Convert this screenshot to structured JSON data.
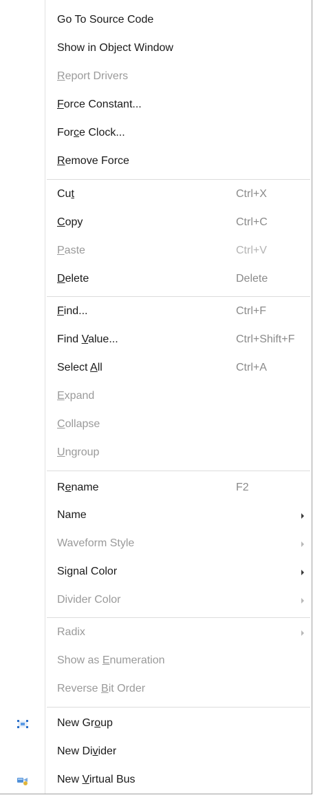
{
  "menu": {
    "items": [
      {
        "pre": "Go To Source Code",
        "mn": "",
        "post": "",
        "shortcut": "",
        "enabled": true,
        "submenu": false
      },
      {
        "pre": "Show in Object Window",
        "mn": "",
        "post": "",
        "shortcut": "",
        "enabled": true,
        "submenu": false
      },
      {
        "pre": "",
        "mn": "R",
        "post": "eport Drivers",
        "shortcut": "",
        "enabled": false,
        "submenu": false
      },
      {
        "pre": "",
        "mn": "F",
        "post": "orce Constant...",
        "shortcut": "",
        "enabled": true,
        "submenu": false
      },
      {
        "pre": "For",
        "mn": "c",
        "post": "e Clock...",
        "shortcut": "",
        "enabled": true,
        "submenu": false
      },
      {
        "pre": "",
        "mn": "R",
        "post": "emove Force",
        "shortcut": "",
        "enabled": true,
        "submenu": false
      },
      {
        "pre": "Cu",
        "mn": "t",
        "post": "",
        "shortcut": "Ctrl+X",
        "enabled": true,
        "submenu": false
      },
      {
        "pre": "",
        "mn": "C",
        "post": "opy",
        "shortcut": "Ctrl+C",
        "enabled": true,
        "submenu": false
      },
      {
        "pre": "",
        "mn": "P",
        "post": "aste",
        "shortcut": "Ctrl+V",
        "enabled": false,
        "submenu": false
      },
      {
        "pre": "",
        "mn": "D",
        "post": "elete",
        "shortcut": "Delete",
        "enabled": true,
        "submenu": false
      },
      {
        "pre": "",
        "mn": "F",
        "post": "ind...",
        "shortcut": "Ctrl+F",
        "enabled": true,
        "submenu": false
      },
      {
        "pre": "Find ",
        "mn": "V",
        "post": "alue...",
        "shortcut": "Ctrl+Shift+F",
        "enabled": true,
        "submenu": false
      },
      {
        "pre": "Select ",
        "mn": "A",
        "post": "ll",
        "shortcut": "Ctrl+A",
        "enabled": true,
        "submenu": false
      },
      {
        "pre": "",
        "mn": "E",
        "post": "xpand",
        "shortcut": "",
        "enabled": false,
        "submenu": false
      },
      {
        "pre": "",
        "mn": "C",
        "post": "ollapse",
        "shortcut": "",
        "enabled": false,
        "submenu": false
      },
      {
        "pre": "",
        "mn": "U",
        "post": "ngroup",
        "shortcut": "",
        "enabled": false,
        "submenu": false
      },
      {
        "pre": "R",
        "mn": "e",
        "post": "name",
        "shortcut": "F2",
        "enabled": true,
        "submenu": false
      },
      {
        "pre": "Name",
        "mn": "",
        "post": "",
        "shortcut": "",
        "enabled": true,
        "submenu": true
      },
      {
        "pre": "Waveform Style",
        "mn": "",
        "post": "",
        "shortcut": "",
        "enabled": false,
        "submenu": true
      },
      {
        "pre": "Signal Color",
        "mn": "",
        "post": "",
        "shortcut": "",
        "enabled": true,
        "submenu": true
      },
      {
        "pre": "Divider Color",
        "mn": "",
        "post": "",
        "shortcut": "",
        "enabled": false,
        "submenu": true
      },
      {
        "pre": "Radix",
        "mn": "",
        "post": "",
        "shortcut": "",
        "enabled": false,
        "submenu": true
      },
      {
        "pre": "Show as ",
        "mn": "E",
        "post": "numeration",
        "shortcut": "",
        "enabled": false,
        "submenu": false
      },
      {
        "pre": "Reverse ",
        "mn": "B",
        "post": "it Order",
        "shortcut": "",
        "enabled": false,
        "submenu": false
      },
      {
        "pre": "New Gr",
        "mn": "o",
        "post": "up",
        "shortcut": "",
        "enabled": true,
        "submenu": false,
        "icon": "new-group-icon"
      },
      {
        "pre": "New Di",
        "mn": "v",
        "post": "ider",
        "shortcut": "",
        "enabled": true,
        "submenu": false
      },
      {
        "pre": "New ",
        "mn": "V",
        "post": "irtual Bus",
        "shortcut": "",
        "enabled": true,
        "submenu": false,
        "icon": "virtual-bus-icon"
      }
    ]
  }
}
